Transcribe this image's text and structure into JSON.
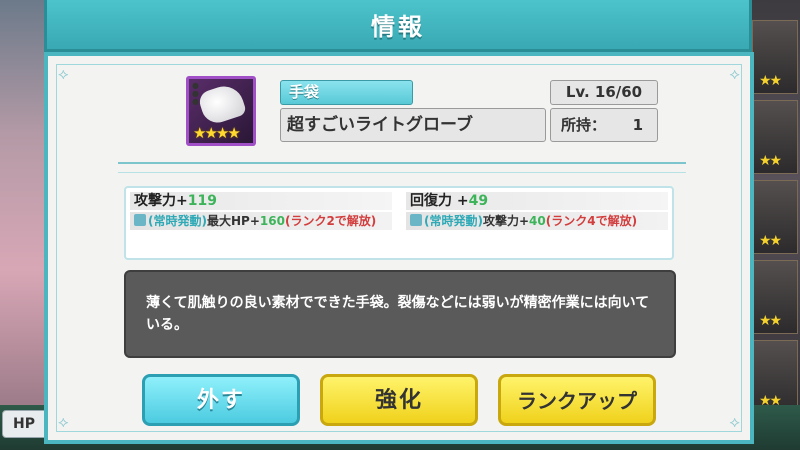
{
  "header": {
    "title": "情報"
  },
  "item": {
    "type": "手袋",
    "name": "超すごいライトグローブ",
    "level": "Lv. 16/60",
    "owned_label": "所持：",
    "owned_value": "1",
    "rarity_stars": "★★★★",
    "rarity_color": "#a14fc7"
  },
  "stats": {
    "attack": {
      "label": "攻撃力+",
      "value": "119"
    },
    "attack_sub": {
      "tag": "(常時発動)",
      "stat": "最大HP+",
      "value": "160",
      "cond": "(ランク2で解放)"
    },
    "recovery": {
      "label": "回復力 +",
      "value": "49"
    },
    "recovery_sub": {
      "tag": "(常時発動)",
      "stat": "攻撃力+",
      "value": "40",
      "cond": "(ランク4で解放)"
    }
  },
  "description": "薄くて肌触りの良い素材でできた手袋。裂傷などには弱いが精密作業には向いている。",
  "buttons": {
    "remove": "外す",
    "enhance": "強化",
    "rankup": "ランクアップ"
  },
  "background": {
    "hp_label": "HP",
    "card_stars": "★★"
  },
  "colors": {
    "accent": "#4cb6c0",
    "stat_value_green": "#3db35a",
    "locked_red": "#d23d3d",
    "button_yellow": "#f0d21c",
    "button_cyan": "#4ccbe0"
  }
}
